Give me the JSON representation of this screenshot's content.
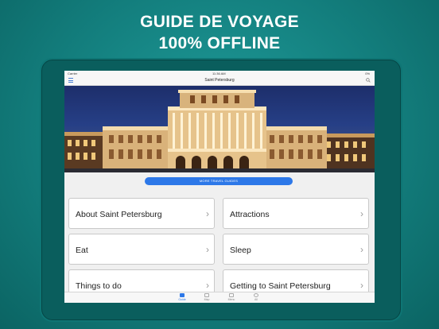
{
  "promo": {
    "line1": "GUIDE DE VOYAGE",
    "line2": "100% OFFLINE"
  },
  "statusbar": {
    "carrier": "Carrier",
    "time": "11:36 AM",
    "battery": "0%"
  },
  "navbar": {
    "title": "Saint Petersburg",
    "menu_icon": "hamburger-icon",
    "search_icon": "search-icon"
  },
  "cta": {
    "label": "MORE TRAVEL GUIDES"
  },
  "cards": [
    {
      "label": "About Saint Petersburg"
    },
    {
      "label": "Attractions"
    },
    {
      "label": "Eat"
    },
    {
      "label": "Sleep"
    },
    {
      "label": "Things to do"
    },
    {
      "label": "Getting to Saint Petersburg"
    }
  ],
  "tabbar": {
    "tabs": [
      {
        "label": "Guide",
        "icon": "book-icon"
      },
      {
        "label": "Map",
        "icon": "map-icon"
      },
      {
        "label": "Menu",
        "icon": "bag-icon"
      },
      {
        "label": "All",
        "icon": "globe-icon"
      }
    ]
  },
  "colors": {
    "accent": "#2d78e8",
    "background": "#137e7d"
  }
}
